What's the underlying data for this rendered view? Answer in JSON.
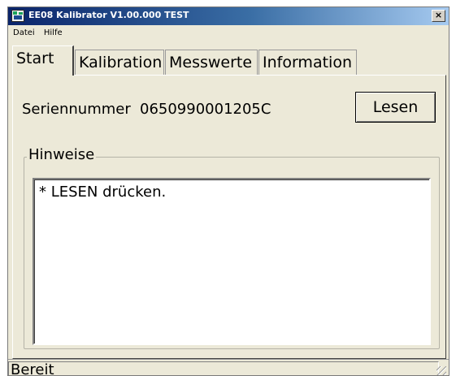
{
  "window": {
    "title": "EE08 Kalibrator V1.00.000 TEST",
    "close_glyph": "×"
  },
  "menu": {
    "items": [
      {
        "label": "Datei"
      },
      {
        "label": "Hilfe"
      }
    ]
  },
  "tabs": [
    {
      "label": "Start",
      "active": true
    },
    {
      "label": "Kalibration",
      "active": false
    },
    {
      "label": "Messwerte",
      "active": false
    },
    {
      "label": "Information",
      "active": false
    }
  ],
  "start": {
    "serial_label": "Seriennummer",
    "serial_value": "0650990001205C",
    "read_button": "Lesen",
    "hints_title": "Hinweise",
    "hints_text": "* LESEN drücken."
  },
  "status": {
    "text": "Bereit"
  },
  "colors": {
    "titlebar_start": "#0a246a",
    "titlebar_end": "#a6caf0",
    "face": "#ece9d8"
  }
}
